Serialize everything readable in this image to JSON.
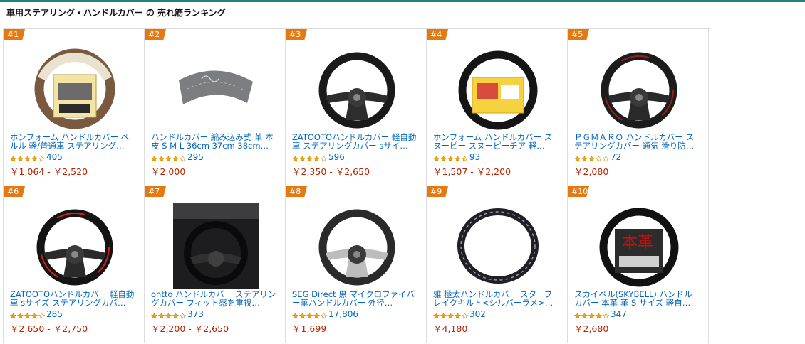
{
  "page": {
    "heading": "車用ステアリング・ハンドルカバー の 売れ筋ランキング",
    "accent_color": "#22807e",
    "rank_badge_color": "#e47911",
    "title_color": "#0066c0",
    "price_color": "#b12704"
  },
  "products": [
    {
      "rank": "#1",
      "title": "ホンフォーム ハンドルカバー ペルル 軽/普通車 ステアリング…",
      "rating": 4.0,
      "reviews": "405",
      "price": "￥1,064 - ￥2,520",
      "image": "steering-wheel-cover-beige-brown"
    },
    {
      "rank": "#2",
      "title": "ハンドルカバー 編み込み式 革 本皮 S M L 36cm 37cm 38cm…",
      "rating": 4.0,
      "reviews": "295",
      "price": "￥2,000",
      "image": "lace-on-leather-cover-grey"
    },
    {
      "rank": "#3",
      "title": "ZATOOTOハンドルカバー 軽自動車 ステアリングカバー sサイ…",
      "rating": 4.0,
      "reviews": "596",
      "price": "￥2,350 - ￥2,650",
      "image": "steering-wheel-black"
    },
    {
      "rank": "#4",
      "title": "ホンフォーム ハンドルカバー スヌーピー スヌーピーチア 軽…",
      "rating": 4.5,
      "reviews": "93",
      "price": "￥1,507 - ￥2,200",
      "image": "steering-cover-snoopy-package"
    },
    {
      "rank": "#5",
      "title": "ＰＧＭＡＲＯ ハンドルカバー ステアリングカバー 通気 滑り防…",
      "rating": 3.0,
      "reviews": "72",
      "price": "￥2,080",
      "image": "steering-wheel-red-stitch"
    },
    {
      "rank": "#6",
      "title": "ZATOOTOハンドルカバー 軽自動車 sサイズ ステアリングカバ…",
      "rating": 4.0,
      "reviews": "285",
      "price": "￥2,650 - ￥2,750",
      "image": "steering-wheel-red-trim"
    },
    {
      "rank": "#7",
      "title": "ontto ハンドルカバー ステアリングカバー フィット感を重視…",
      "rating": 4.0,
      "reviews": "373",
      "price": "￥2,200 - ￥2,650",
      "image": "car-interior-steering-photo"
    },
    {
      "rank": "#8",
      "title": "SEG Direct 黒 マイクロファイバー革ハンドルカバー 外径…",
      "rating": 4.0,
      "reviews": "17,806",
      "price": "￥1,699",
      "image": "steering-wheel-grey-cover"
    },
    {
      "rank": "#9",
      "title": "雅 極太ハンドルカバー スターフレイクキルト<シルバーラメ>…",
      "rating": 4.0,
      "reviews": "302",
      "price": "￥4,180",
      "image": "quilted-ring-cover"
    },
    {
      "rank": "#10",
      "title": "スカイベル(SKYBELL) ハンドルカバー 本革 革 S サイズ 軽自…",
      "rating": 4.0,
      "reviews": "347",
      "price": "￥2,680",
      "image": "honkawa-package-cover"
    }
  ]
}
